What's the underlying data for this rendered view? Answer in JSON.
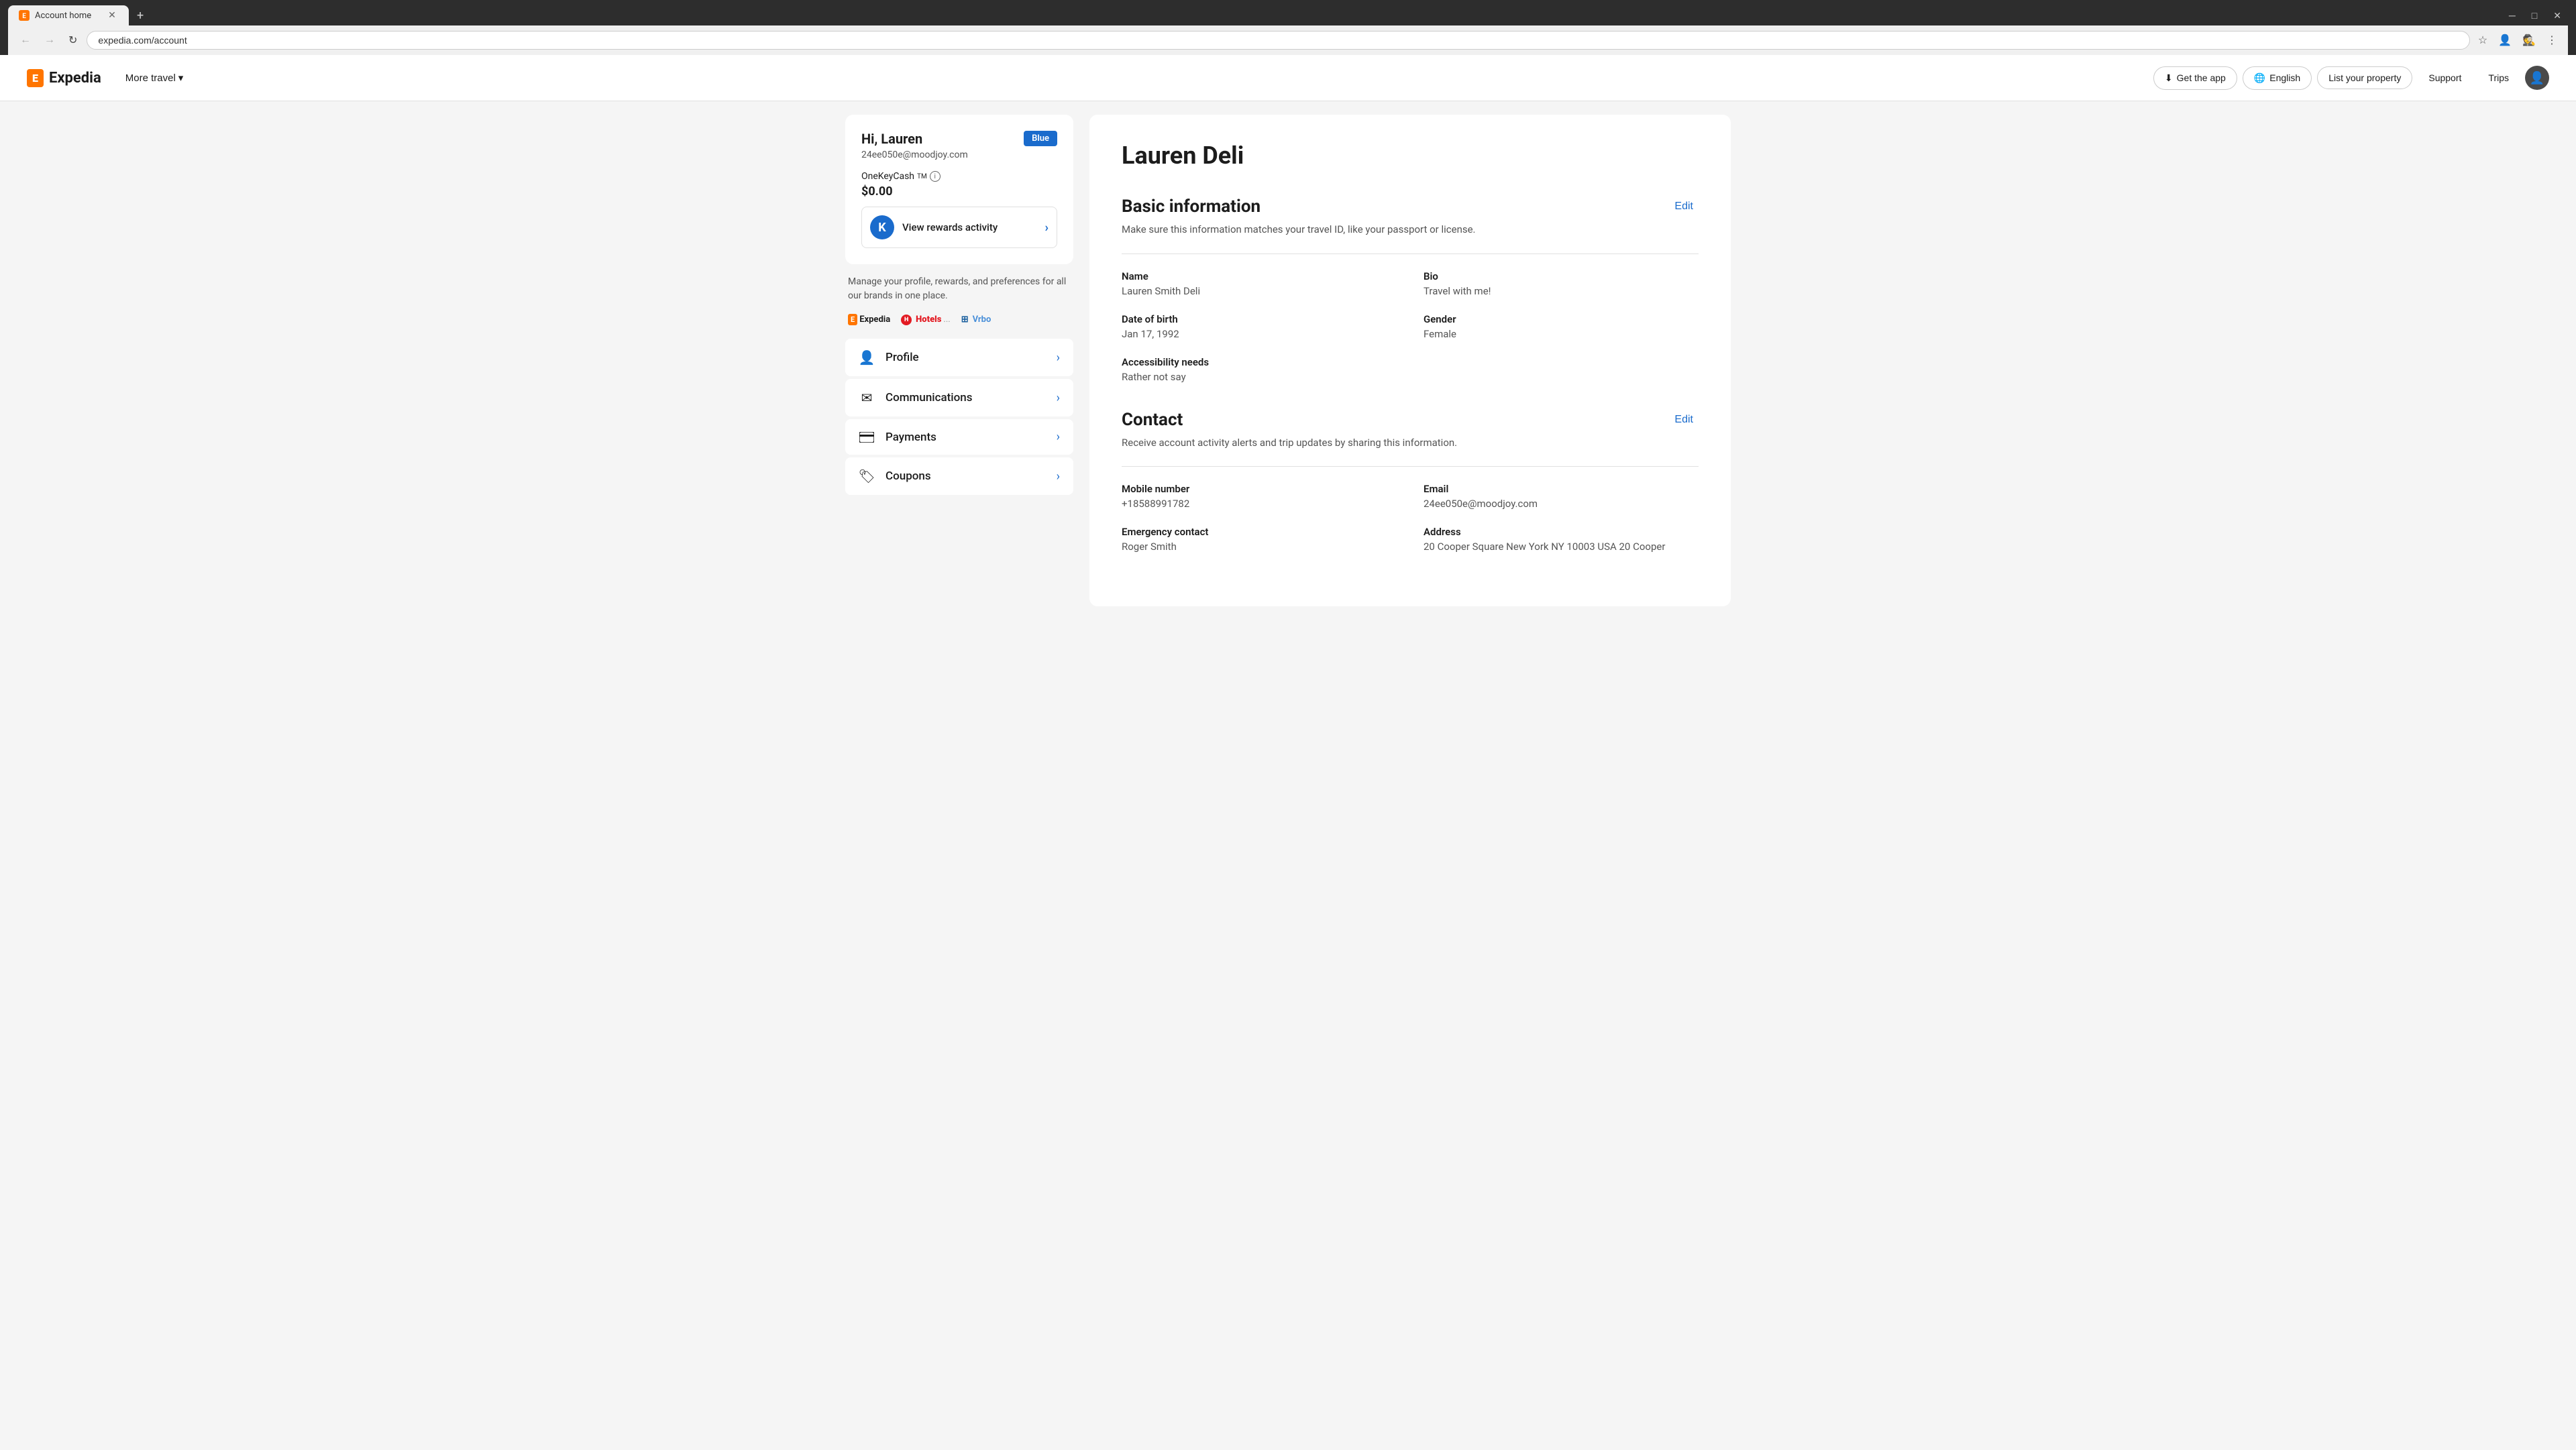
{
  "browser": {
    "tab_title": "Account home",
    "tab_favicon": "E",
    "url": "expedia.com/account",
    "add_tab_label": "+",
    "nav": {
      "back": "←",
      "forward": "→",
      "refresh": "↻"
    },
    "window_controls": {
      "minimize": "─",
      "maximize": "□",
      "close": "✕"
    },
    "incognito_label": "Incognito"
  },
  "header": {
    "logo_text": "Expedia",
    "more_travel": "More travel",
    "more_travel_chevron": "▾",
    "get_app": "Get the app",
    "get_app_icon": "⬇",
    "language": "English",
    "language_icon": "🌐",
    "list_property": "List your property",
    "support": "Support",
    "trips": "Trips"
  },
  "sidebar": {
    "greeting": "Hi, Lauren",
    "email": "24ee050e@moodjoy.com",
    "tier": "Blue",
    "onekeycash_label": "OneKeyCash",
    "tm_label": "TM",
    "cash_amount": "$0.00",
    "rewards_link_text": "View rewards activity",
    "manage_text": "Manage your profile, rewards, and preferences for all our brands in one place.",
    "brands": [
      {
        "name": "Expedia",
        "type": "expedia"
      },
      {
        "name": "Hotels.com",
        "type": "hotels"
      },
      {
        "name": "Vrbo",
        "type": "vrbo"
      }
    ],
    "nav_items": [
      {
        "id": "profile",
        "label": "Profile",
        "icon": "👤"
      },
      {
        "id": "communications",
        "label": "Communications",
        "icon": "✉"
      },
      {
        "id": "payments",
        "label": "Payments",
        "icon": "💳"
      },
      {
        "id": "coupons",
        "label": "Coupons",
        "icon": "🏷"
      }
    ]
  },
  "profile": {
    "full_name": "Lauren Deli",
    "basic_info": {
      "section_title": "Basic information",
      "section_subtitle": "Make sure this information matches your travel ID, like your passport or license.",
      "edit_label": "Edit",
      "fields": [
        {
          "id": "name",
          "label": "Name",
          "value": "Lauren Smith Deli"
        },
        {
          "id": "bio",
          "label": "Bio",
          "value": "Travel with me!"
        },
        {
          "id": "dob",
          "label": "Date of birth",
          "value": "Jan 17, 1992"
        },
        {
          "id": "gender",
          "label": "Gender",
          "value": "Female"
        },
        {
          "id": "accessibility",
          "label": "Accessibility needs",
          "value": "Rather not say"
        },
        {
          "id": "spacer",
          "label": "",
          "value": ""
        }
      ]
    },
    "contact": {
      "section_title": "Contact",
      "section_subtitle": "Receive account activity alerts and trip updates by sharing this information.",
      "edit_label": "Edit",
      "fields": [
        {
          "id": "mobile",
          "label": "Mobile number",
          "value": "+18588991782"
        },
        {
          "id": "email",
          "label": "Email",
          "value": "24ee050e@moodjoy.com"
        },
        {
          "id": "emergency",
          "label": "Emergency contact",
          "value": "Roger Smith"
        },
        {
          "id": "address",
          "label": "Address",
          "value": "20 Cooper Square New York NY 10003 USA 20 Cooper"
        }
      ]
    }
  }
}
